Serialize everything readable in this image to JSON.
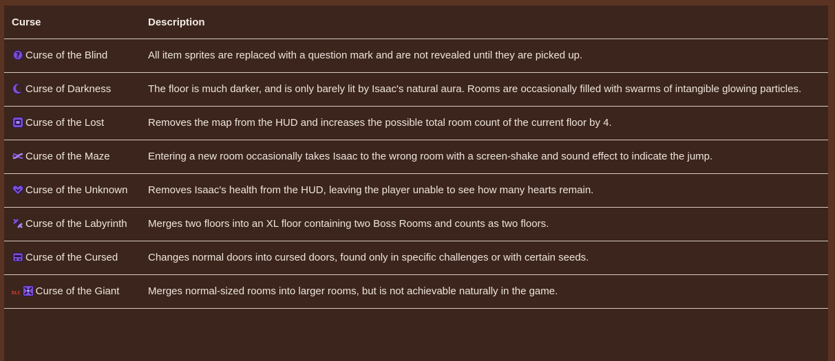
{
  "table": {
    "headers": {
      "curse": "Curse",
      "description": "Description"
    },
    "rows": [
      {
        "icon": "curse-of-the-blind-icon",
        "name": "Curse of the Blind",
        "description": "All item sprites are replaced with a question mark and are not revealed until they are picked up."
      },
      {
        "icon": "curse-of-darkness-icon",
        "name": "Curse of Darkness",
        "description": "The floor is much darker, and is only barely lit by Isaac's natural aura. Rooms are occasionally filled with swarms of intangible glowing particles."
      },
      {
        "icon": "curse-of-the-lost-icon",
        "name": "Curse of the Lost",
        "description": "Removes the map from the HUD and increases the possible total room count of the current floor by 4."
      },
      {
        "icon": "curse-of-the-maze-icon",
        "name": "Curse of the Maze",
        "description": "Entering a new room occasionally takes Isaac to the wrong room with a screen-shake and sound effect to indicate the jump."
      },
      {
        "icon": "curse-of-the-unknown-icon",
        "name": "Curse of the Unknown",
        "description": "Removes Isaac's health from the HUD, leaving the player unable to see how many hearts remain."
      },
      {
        "icon": "curse-of-the-labyrinth-icon",
        "name": "Curse of the Labyrinth",
        "description": "Merges two floors into an XL floor containing two Boss Rooms and counts as two floors."
      },
      {
        "icon": "curse-of-the-cursed-icon",
        "name": "Curse of the Cursed",
        "description": "Changes normal doors into cursed doors, found only in specific challenges or with certain seeds."
      },
      {
        "icon": "curse-of-the-giant-icon",
        "badge": "DLC",
        "name": "Curse of the Giant",
        "description": "Merges normal-sized rooms into larger rooms, but is not achievable naturally in the game."
      }
    ]
  },
  "colors": {
    "page_background": "#5a3322",
    "table_background": "#3c251c",
    "divider": "#d8ccc4",
    "text": "#ece4dc",
    "icon_purple": "#7b4fd6",
    "dlc_red": "#e23a2e"
  }
}
